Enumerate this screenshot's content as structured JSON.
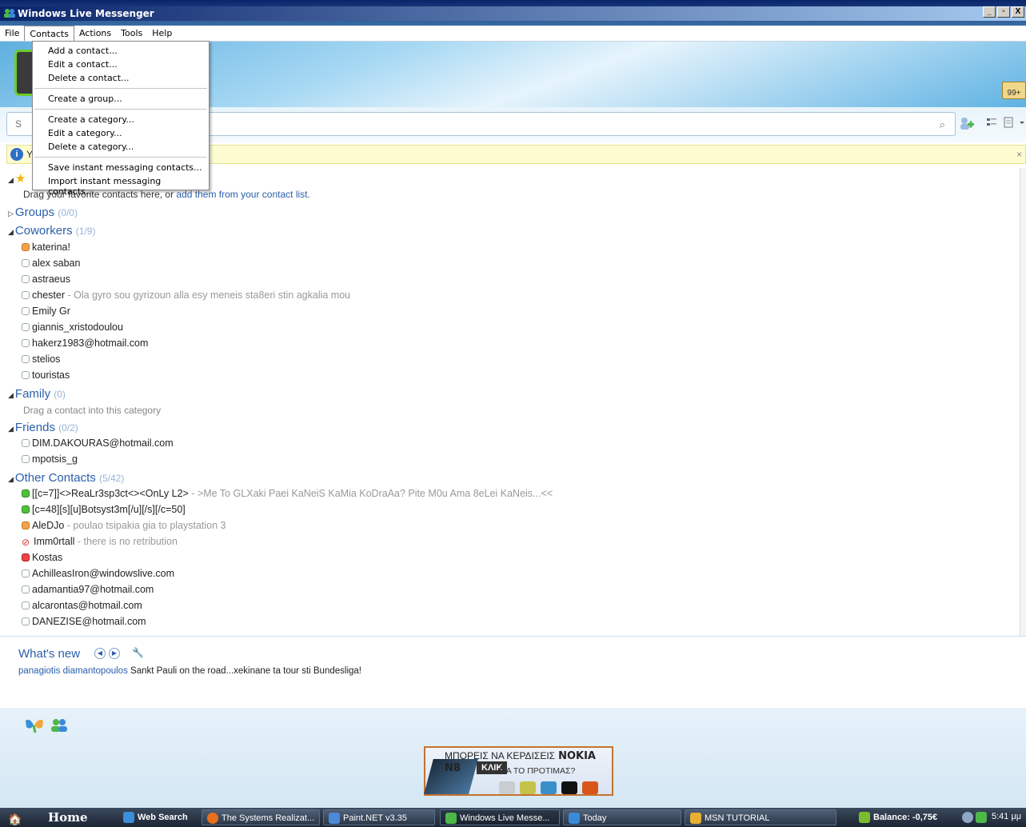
{
  "window": {
    "title": "Windows Live Messenger",
    "buttons": [
      "_",
      "▫",
      "X"
    ]
  },
  "menubar": [
    "File",
    "Contacts",
    "Actions",
    "Tools",
    "Help"
  ],
  "contacts_menu": {
    "items": [
      "Add a contact...",
      "Edit a contact...",
      "Delete a contact...",
      "Create a group...",
      "Create a category...",
      "Edit a category...",
      "Delete a category...",
      "Save instant messaging contacts...",
      "Import instant messaging contacts..."
    ]
  },
  "header": {
    "badge_text": "99+"
  },
  "search": {
    "placeholder": "S"
  },
  "infobar": {
    "text": "Y"
  },
  "favorites": {
    "hint": "Drag your favorite contacts here, or ",
    "link": "add them from your contact list."
  },
  "groups": [
    {
      "name": "Groups",
      "count": "(0/0)",
      "collapsed": true
    },
    {
      "name": "Coworkers",
      "count": "(1/9)"
    },
    {
      "name": "Family",
      "count": "(0)",
      "hint": "Drag a contact into this category"
    },
    {
      "name": "Friends",
      "count": "(0/2)"
    },
    {
      "name": "Other Contacts",
      "count": "(5/42)"
    }
  ],
  "coworkers": [
    {
      "name": "katerina!",
      "status": "away"
    },
    {
      "name": "alex saban",
      "status": "offline"
    },
    {
      "name": "astraeus",
      "status": "offline"
    },
    {
      "name": "chester",
      "message": " - Ola gyro sou gyrizoun alla esy meneis sta8eri stin agkalia mou",
      "status": "offline"
    },
    {
      "name": "Emily Gr",
      "status": "offline"
    },
    {
      "name": "giannis_xristodoulou",
      "status": "offline"
    },
    {
      "name": "hakerz1983@hotmail.com",
      "status": "offline"
    },
    {
      "name": "stelios",
      "status": "offline"
    },
    {
      "name": "touristas",
      "status": "offline"
    }
  ],
  "friends": [
    {
      "name": "DIM.DAKOURAS@hotmail.com",
      "status": "offline"
    },
    {
      "name": "mpotsis_g",
      "status": "offline"
    }
  ],
  "other_contacts": [
    {
      "name": "[[c=7]]<>ReaLr3sp3ct<><OnLy L2>",
      "message": " - >Me To GLXaki Paei KaNeiS KaMia KoDraAa? Pite M0u Ama 8eLei KaNeis...<<",
      "status": "online"
    },
    {
      "name": "[c=48][s][u]Botsyst3m[/u][/s][/c=50]",
      "status": "online"
    },
    {
      "name": "AleDJo",
      "message": " - poulao tsipakia gia to playstation 3",
      "status": "away"
    },
    {
      "name": "Imm0rtall",
      "message": " - there is no retribution",
      "status": "blocked"
    },
    {
      "name": "Kostas",
      "status": "busy"
    },
    {
      "name": "AchilleasIron@windowslive.com",
      "status": "offline"
    },
    {
      "name": "adamantia97@hotmail.com",
      "status": "offline"
    },
    {
      "name": "alcarontas@hotmail.com",
      "status": "offline"
    },
    {
      "name": "DANEZISE@hotmail.com",
      "status": "offline"
    }
  ],
  "whats_new": {
    "title": "What's new",
    "who": "panagiotis diamantopoulos",
    "text": " Sankt Pauli on the road...xekinane ta tour sti Bundesliga!"
  },
  "ad": {
    "headline": "ΜΠΟΡΕΙΣ ΝΑ ΚΕΡΔΙΣΕΙΣ",
    "brand": "NOKIA N8",
    "sub": "ΜΑ ΤΟ ΠΡΟΤΙΜΑΣ?",
    "cta": "ΚΛΙΚ",
    "swatches": [
      "#c9ccd0",
      "#c5c24a",
      "#3a8fc9",
      "#111111",
      "#d8561a"
    ]
  },
  "taskbar": {
    "home": "Home",
    "items": [
      "Web Search",
      "The Systems Realizat...",
      "Paint.NET v3.35",
      "Windows Live Messe...",
      "Today",
      "MSN TUTORIAL"
    ],
    "balance": "Balance: -0,75€",
    "clock": "5:41 μμ"
  }
}
